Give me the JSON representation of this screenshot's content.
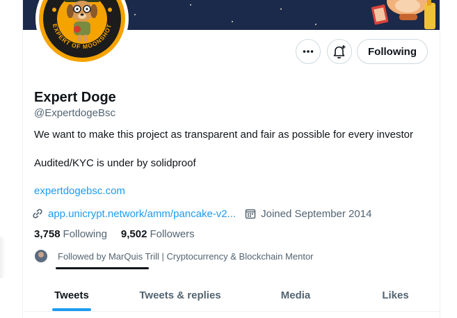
{
  "profile": {
    "display_name": "Expert Doge",
    "handle": "@ExpertdogeBsc",
    "avatar_text": "EXPERT OF MOONSHOT",
    "bio_line_1": "We want to make this project as transparent and fair as possible for every investor",
    "bio_line_2": "Audited/KYC is under by solidproof",
    "website": "expertdogebsc.com",
    "location_link": "app.unicrypt.network/amm/pancake-v2...",
    "joined": "Joined September 2014",
    "following_count": "3,758",
    "following_label": "Following",
    "followers_count": "9,502",
    "followers_label": "Followers",
    "followed_by": "Followed by MarQuis Trill | Cryptocurrency & Blockchain Mentor"
  },
  "actions": {
    "more_icon": "more-horizontal-icon",
    "notify_icon": "bell-plus-icon",
    "following_label": "Following"
  },
  "tabs": [
    {
      "label": "Tweets",
      "active": true
    },
    {
      "label": "Tweets & replies",
      "active": false
    },
    {
      "label": "Media",
      "active": false
    },
    {
      "label": "Likes",
      "active": false
    }
  ],
  "colors": {
    "accent": "#1d9bf0",
    "banner": "#1b2a4a",
    "avatar_ring": "#f5a300"
  }
}
